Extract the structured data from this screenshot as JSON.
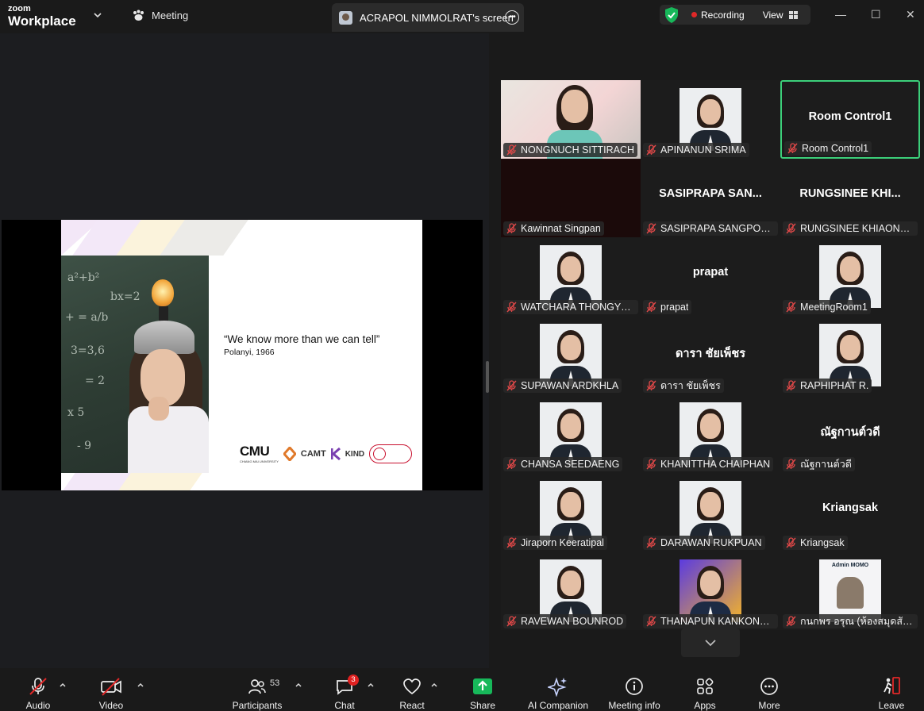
{
  "titlebar": {
    "logo_line1": "zoom",
    "logo_line2": "Workplace",
    "meeting_tab": "Meeting",
    "screen_tab": "ACRAPOL NIMMOLRAT's screen",
    "recording": "Recording",
    "view": "View",
    "minimize": "—",
    "maximize": "☐",
    "close": "✕"
  },
  "slide": {
    "quote": "“We know more than we can tell”",
    "author": "Polanyi, 1966",
    "logo_cmu": "CMU",
    "logo_cmu_sub": "CHIANG MAI UNIVERSITY",
    "logo_camt": "CAMT",
    "logo_kind": "KIND",
    "logo_bsi": "bsi"
  },
  "gallery": {
    "tiles": [
      {
        "label": "NONGNUCH SITTIRACH",
        "type": "photo-bright"
      },
      {
        "label": "APINANUN SRIMA",
        "type": "photo"
      },
      {
        "label": "Room Control1",
        "type": "name",
        "big": "Room Control1",
        "active": true
      },
      {
        "label": "Kawinnat Singpan",
        "type": "dark"
      },
      {
        "label": "SASIPRAPA SANGPONG...",
        "type": "name",
        "big": "SASIPRAPA  SAN..."
      },
      {
        "label": "RUNGSINEE KHIAONGA...",
        "type": "name",
        "big": "RUNGSINEE  KHI..."
      },
      {
        "label": "WATCHARA THONGYOD",
        "type": "photo"
      },
      {
        "label": "prapat",
        "type": "name",
        "big": "prapat"
      },
      {
        "label": "MeetingRoom1",
        "type": "photo"
      },
      {
        "label": "SUPAWAN ARDKHLA",
        "type": "photo"
      },
      {
        "label": "ดารา ชัยเพ็ชร",
        "type": "name",
        "big": "ดารา ชัยเพ็ชร"
      },
      {
        "label": "RAPHIPHAT R.",
        "type": "photo"
      },
      {
        "label": "CHANSA SEEDAENG",
        "type": "photo"
      },
      {
        "label": "KHANITTHA CHAIPHAN",
        "type": "photo"
      },
      {
        "label": "ณัฐกานต์วดี",
        "type": "name",
        "big": "ณัฐกานต์วดี"
      },
      {
        "label": "Jiraporn Keeratipal",
        "type": "photo"
      },
      {
        "label": "DARAWAN RUKPUAN",
        "type": "photo"
      },
      {
        "label": "Kriangsak",
        "type": "name",
        "big": "Kriangsak"
      },
      {
        "label": "RAVEWAN BOUNROD",
        "type": "photo"
      },
      {
        "label": "THANAPUN KANKONSUE",
        "type": "photo-purple"
      },
      {
        "label": "กนกพร  อรุณ (ห้องสมุดสัตว...",
        "type": "photo-admin",
        "admin_title": "Admin MOMO"
      }
    ]
  },
  "toolbar": {
    "audio": "Audio",
    "video": "Video",
    "participants": "Participants",
    "participants_count": "53",
    "chat": "Chat",
    "chat_badge": "3",
    "react": "React",
    "share": "Share",
    "ai_companion": "AI Companion",
    "meeting_info": "Meeting info",
    "apps": "Apps",
    "more": "More",
    "leave": "Leave"
  },
  "colors": {
    "active_border": "#3ccf7a",
    "recording_dot": "#e02828",
    "share_green": "#17b85a",
    "badge_red": "#e02020"
  }
}
